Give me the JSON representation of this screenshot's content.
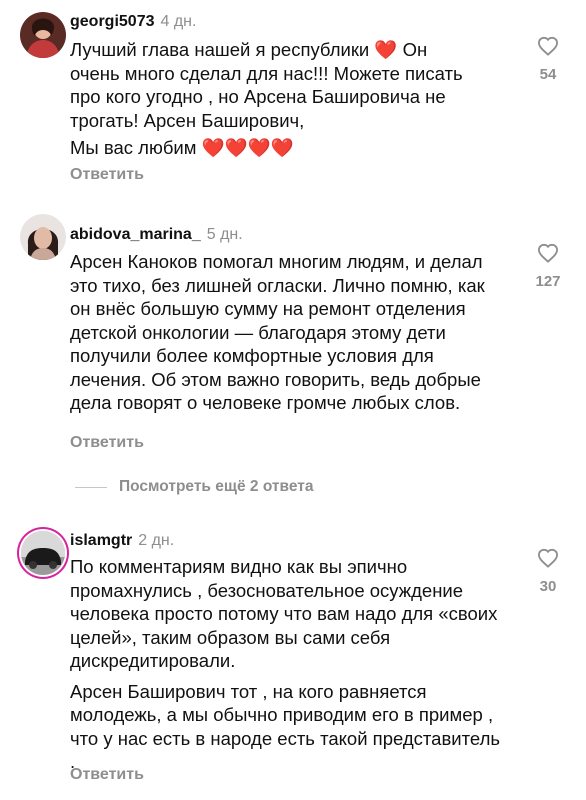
{
  "comments": [
    {
      "username": "georgi5073",
      "time": "4 дн.",
      "text_lines": [
        "Лучший глава нашей я республики",
        "очень много сделал для нас!!! Можете писать",
        "про кого угодно , но Арсена Башировича не",
        "трогать! Арсен Баширович,",
        "Мы вас любим"
      ],
      "line1_tail": "Он",
      "emoji": "❤️",
      "reply_label": "Ответить",
      "likes": "54"
    },
    {
      "username": "abidova_marina_",
      "time": "5 дн.",
      "text": "Арсен Каноков помогал многим людям, и делал это тихо, без лишней огласки. Лично помню, как он внёс большую сумму на ремонт отделения детской онкологии — благодаря этому дети получили более комфортные условия для лечения. Об этом важно говорить, ведь добрые дела говорят о человеке громче любых слов.",
      "reply_label": "Ответить",
      "likes": "127",
      "view_more": "Посмотреть ещё 2 ответа"
    },
    {
      "username": "islamgtr",
      "time": "2 дн.",
      "paragraph1": "По комментариям видно как вы эпично промахнулись , безосновательное осуждение человека просто потому что вам надо для «своих целей», таким образом вы сами себя дискредитировали.",
      "paragraph2": "Арсен Баширович тот , на кого равняется молодежь, а мы обычно приводим его в пример , что у нас есть в народе есть такой представитель .",
      "reply_label": "Ответить",
      "likes": "30"
    }
  ],
  "colors": {
    "text": "#111111",
    "secondary": "#8e8e8e",
    "heart": "#e0142a",
    "story_ring": "#d6249f"
  },
  "icons": [
    "heart-outline-icon",
    "red-heart-emoji"
  ]
}
